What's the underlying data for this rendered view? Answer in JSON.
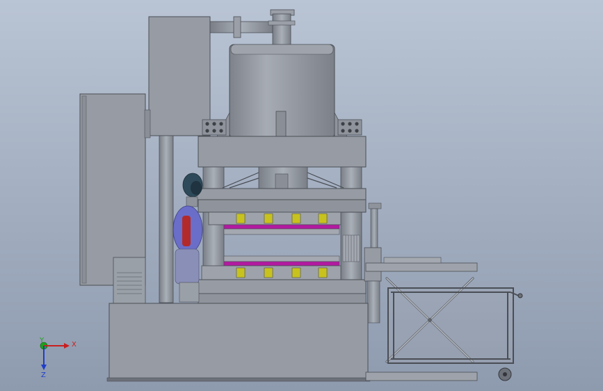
{
  "view": {
    "background_top": "#b9c4d4",
    "background_bottom": "#8e9aae",
    "machine_color": "#8f949c",
    "machine_light": "#a4a9b1",
    "machine_dark": "#6c7078",
    "mold_magenta": "#b21aa0",
    "block_yellow": "#c8c21e",
    "figure_red": "#b32a2a",
    "figure_blue": "#6a6ec8"
  },
  "triad": {
    "x_label": "X",
    "y_label": "Y",
    "z_label": "Z",
    "x_color": "#c81e1e",
    "y_color": "#1ea01e",
    "z_color": "#1e3ec8"
  }
}
